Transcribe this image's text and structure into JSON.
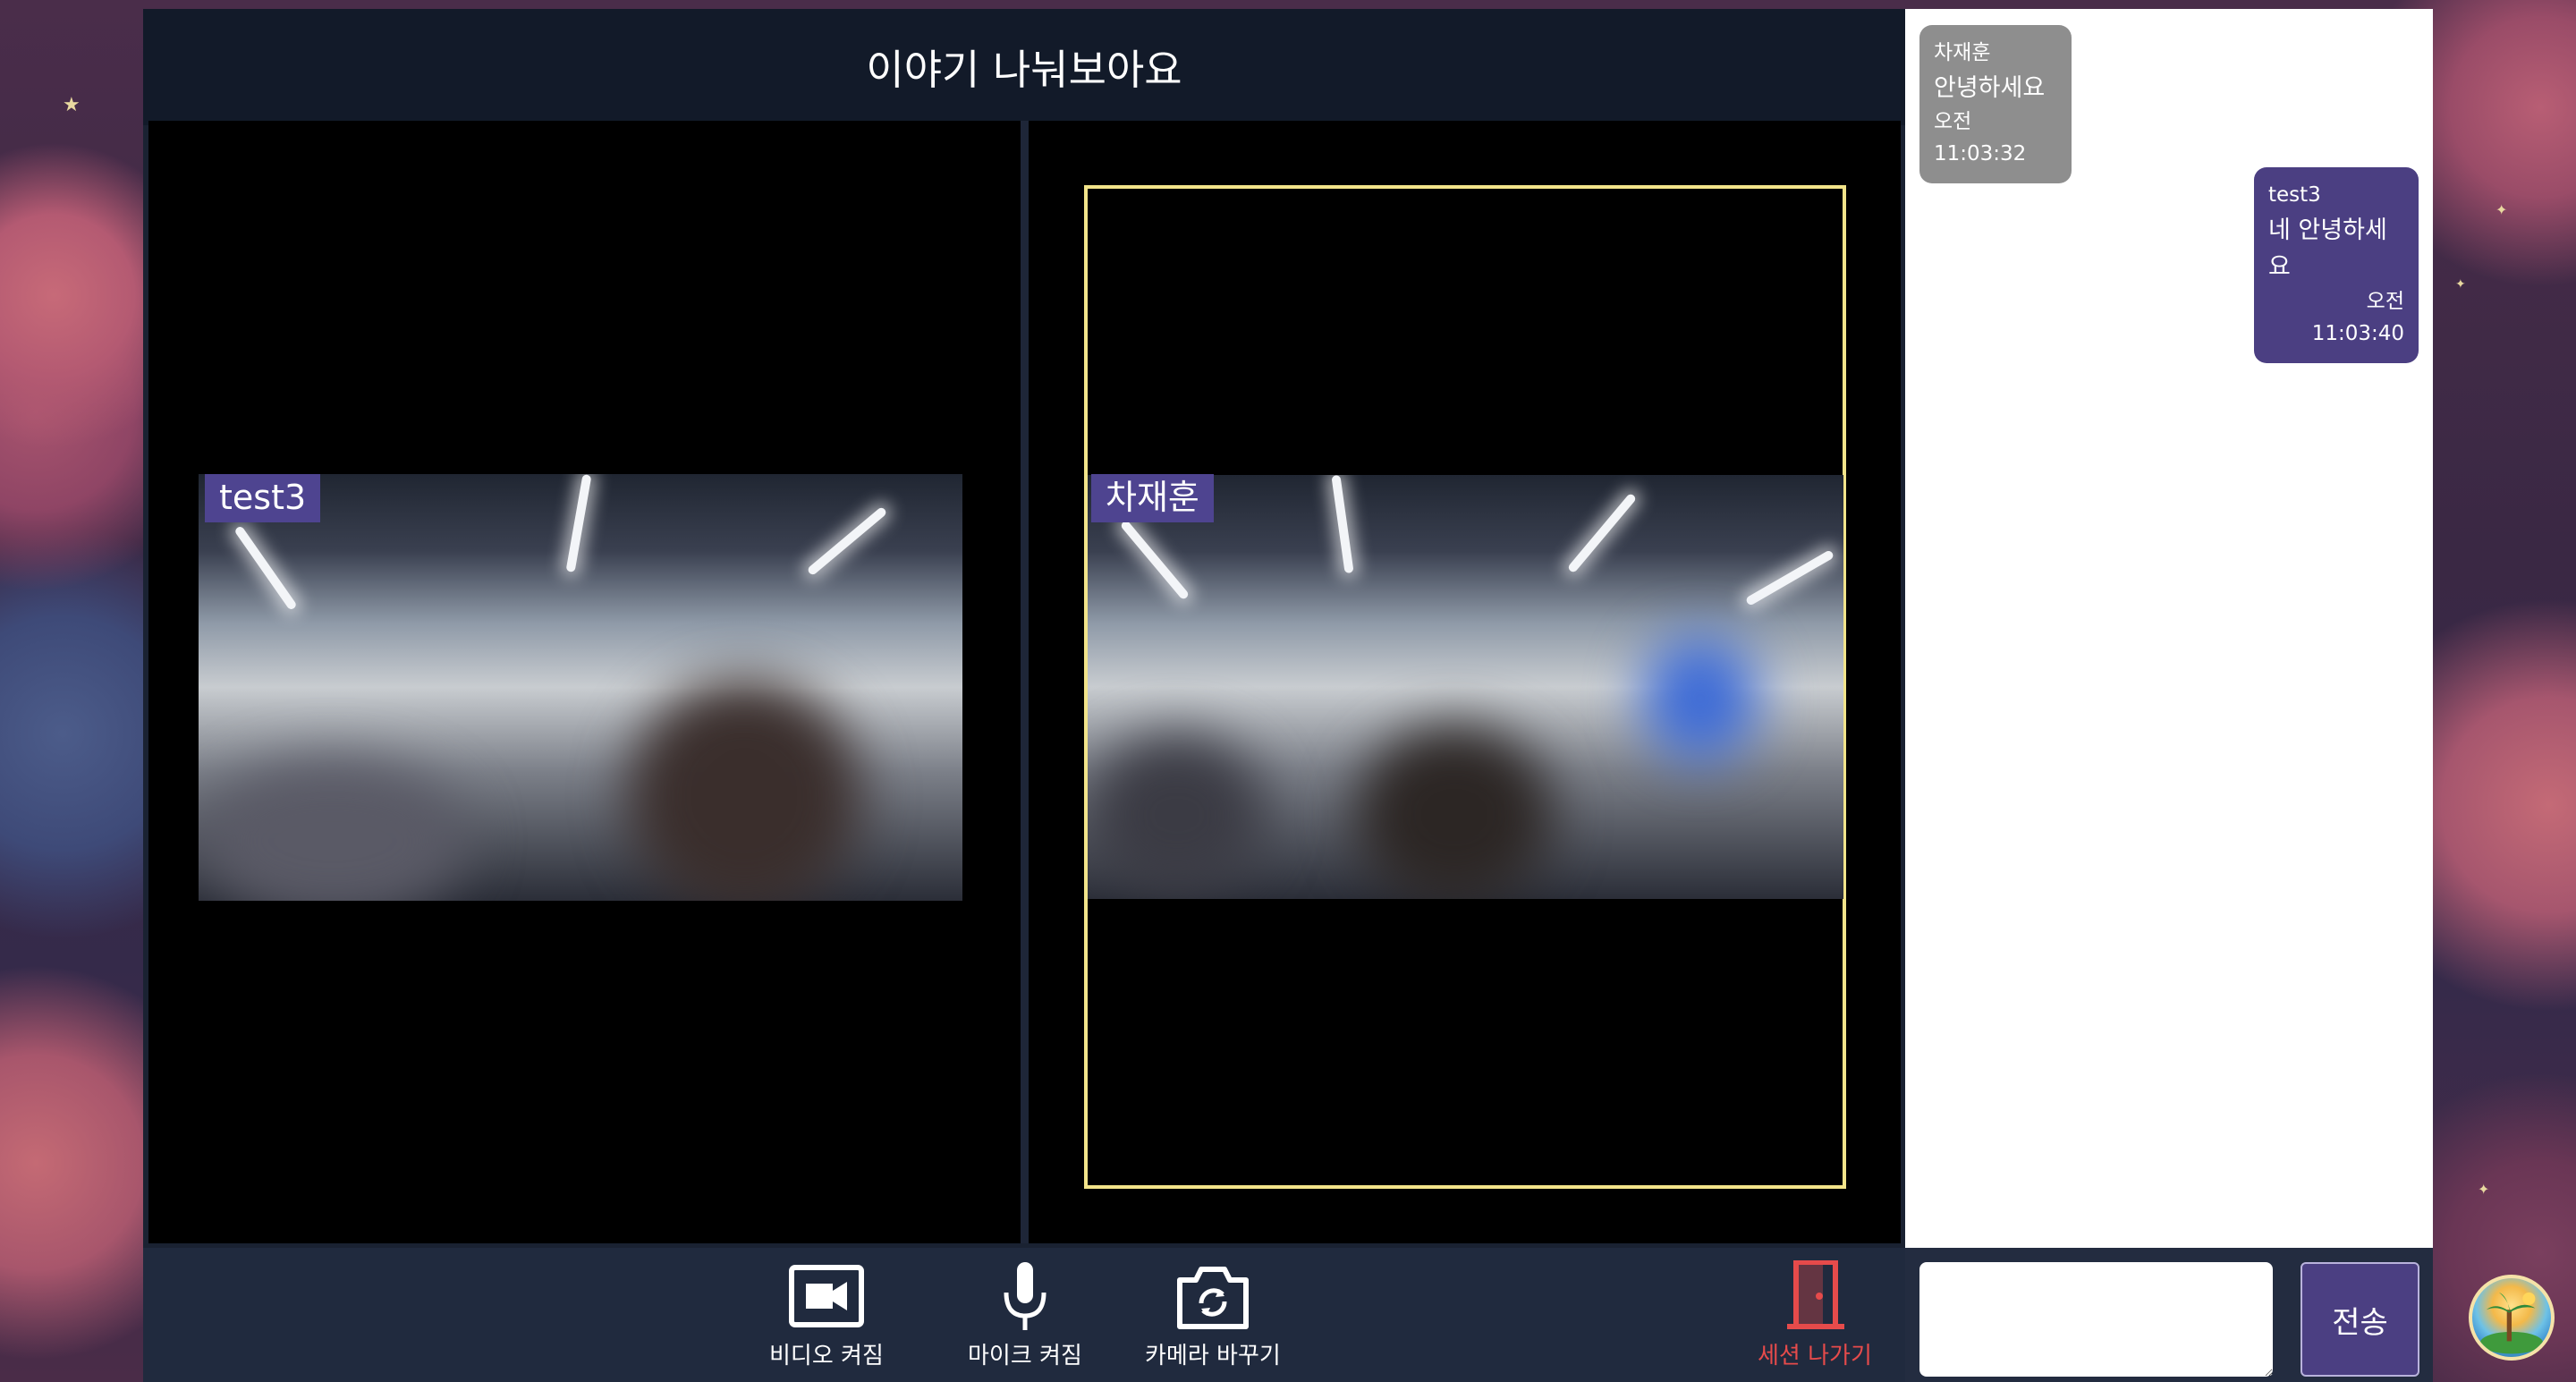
{
  "header": {
    "title": "이야기 나눠보아요"
  },
  "participants": [
    {
      "name": "test3"
    },
    {
      "name": "차재훈"
    }
  ],
  "controls": {
    "video_label": "비디오 켜짐",
    "mic_label": "마이크 켜짐",
    "camera_label": "카메라 바꾸기",
    "leave_label": "세션 나가기"
  },
  "chat": {
    "messages": [
      {
        "sender": "차재훈",
        "text": "안녕하세요",
        "time": "오전 11:03:32"
      },
      {
        "sender": "test3",
        "text": "네 안녕하세요",
        "time": "오전 11:03:40"
      }
    ],
    "input_value": "",
    "send_label": "전송"
  },
  "colors": {
    "accent": "#4b3f82",
    "leave": "#e64b4b",
    "active_outline": "#f2e48a",
    "incoming_bubble": "#8e8e8e"
  },
  "icons": [
    "video-camera-icon",
    "microphone-icon",
    "camera-switch-icon",
    "door-exit-icon",
    "island-avatar-icon"
  ]
}
